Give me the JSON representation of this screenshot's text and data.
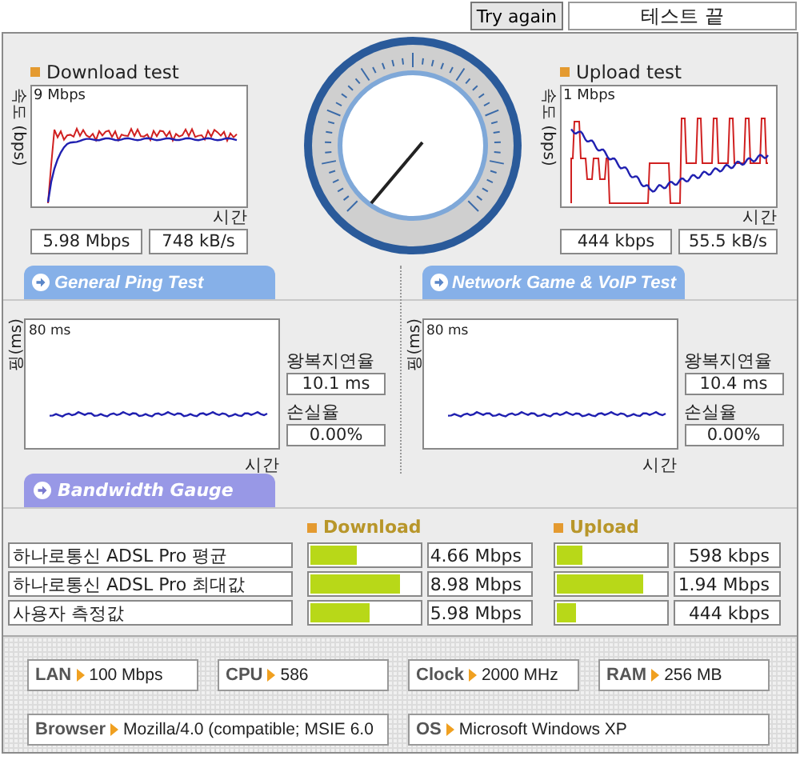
{
  "top_bar": {
    "retry_button": "Try again",
    "status": "테스트 끝"
  },
  "speed_tests": [
    {
      "kind": "download",
      "title": "Download test",
      "axis_label": "속도 (bps)",
      "max_label": "9 Mbps",
      "time_label": "시간",
      "rate": "5.98 Mbps",
      "throughput": "748 kB/s"
    },
    {
      "kind": "upload",
      "title": "Upload test",
      "axis_label": "속도 (bps)",
      "max_label": "1 Mbps",
      "time_label": "시간",
      "rate": "444 kbps",
      "throughput": "55.5 kB/s"
    }
  ],
  "ping_tests": [
    {
      "tab": "General Ping Test",
      "axis_label": "핑(ms)",
      "max_label": "80 ms",
      "time_label": "시간",
      "latency_label": "왕복지연율",
      "latency": "10.1 ms",
      "loss_label": "손실율",
      "loss": "0.00%"
    },
    {
      "tab": "Network Game & VoIP Test",
      "axis_label": "핑(ms)",
      "max_label": "80 ms",
      "time_label": "시간",
      "latency_label": "왕복지연율",
      "latency": "10.4 ms",
      "loss_label": "손실율",
      "loss": "0.00%"
    }
  ],
  "bandwidth": {
    "tab": "Bandwidth Gauge",
    "download_label": "Download",
    "upload_label": "Upload",
    "rows": [
      {
        "name": "하나로통신 ADSL Pro 평균",
        "download": {
          "level": 0.43,
          "reading": "4.66 Mbps"
        },
        "upload": {
          "level": 0.24,
          "reading": "598 kbps"
        }
      },
      {
        "name": "하나로통신 ADSL Pro 최대값",
        "download": {
          "level": 0.82,
          "reading": "8.98 Mbps"
        },
        "upload": {
          "level": 0.79,
          "reading": "1.94 Mbps"
        }
      },
      {
        "name": "사용자 측정값",
        "download": {
          "level": 0.55,
          "reading": "5.98 Mbps"
        },
        "upload": {
          "level": 0.17,
          "reading": "444 kbps"
        }
      }
    ]
  },
  "system_info": [
    {
      "label": "LAN",
      "value": "100 Mbps"
    },
    {
      "label": "CPU",
      "value": "586"
    },
    {
      "label": "Clock",
      "value": "2000 MHz"
    },
    {
      "label": "RAM",
      "value": "256 MB"
    },
    {
      "label": "Browser",
      "value": "Mozilla/4.0 (compatible; MSIE 6.0"
    },
    {
      "label": "OS",
      "value": "Microsoft Windows XP"
    }
  ]
}
